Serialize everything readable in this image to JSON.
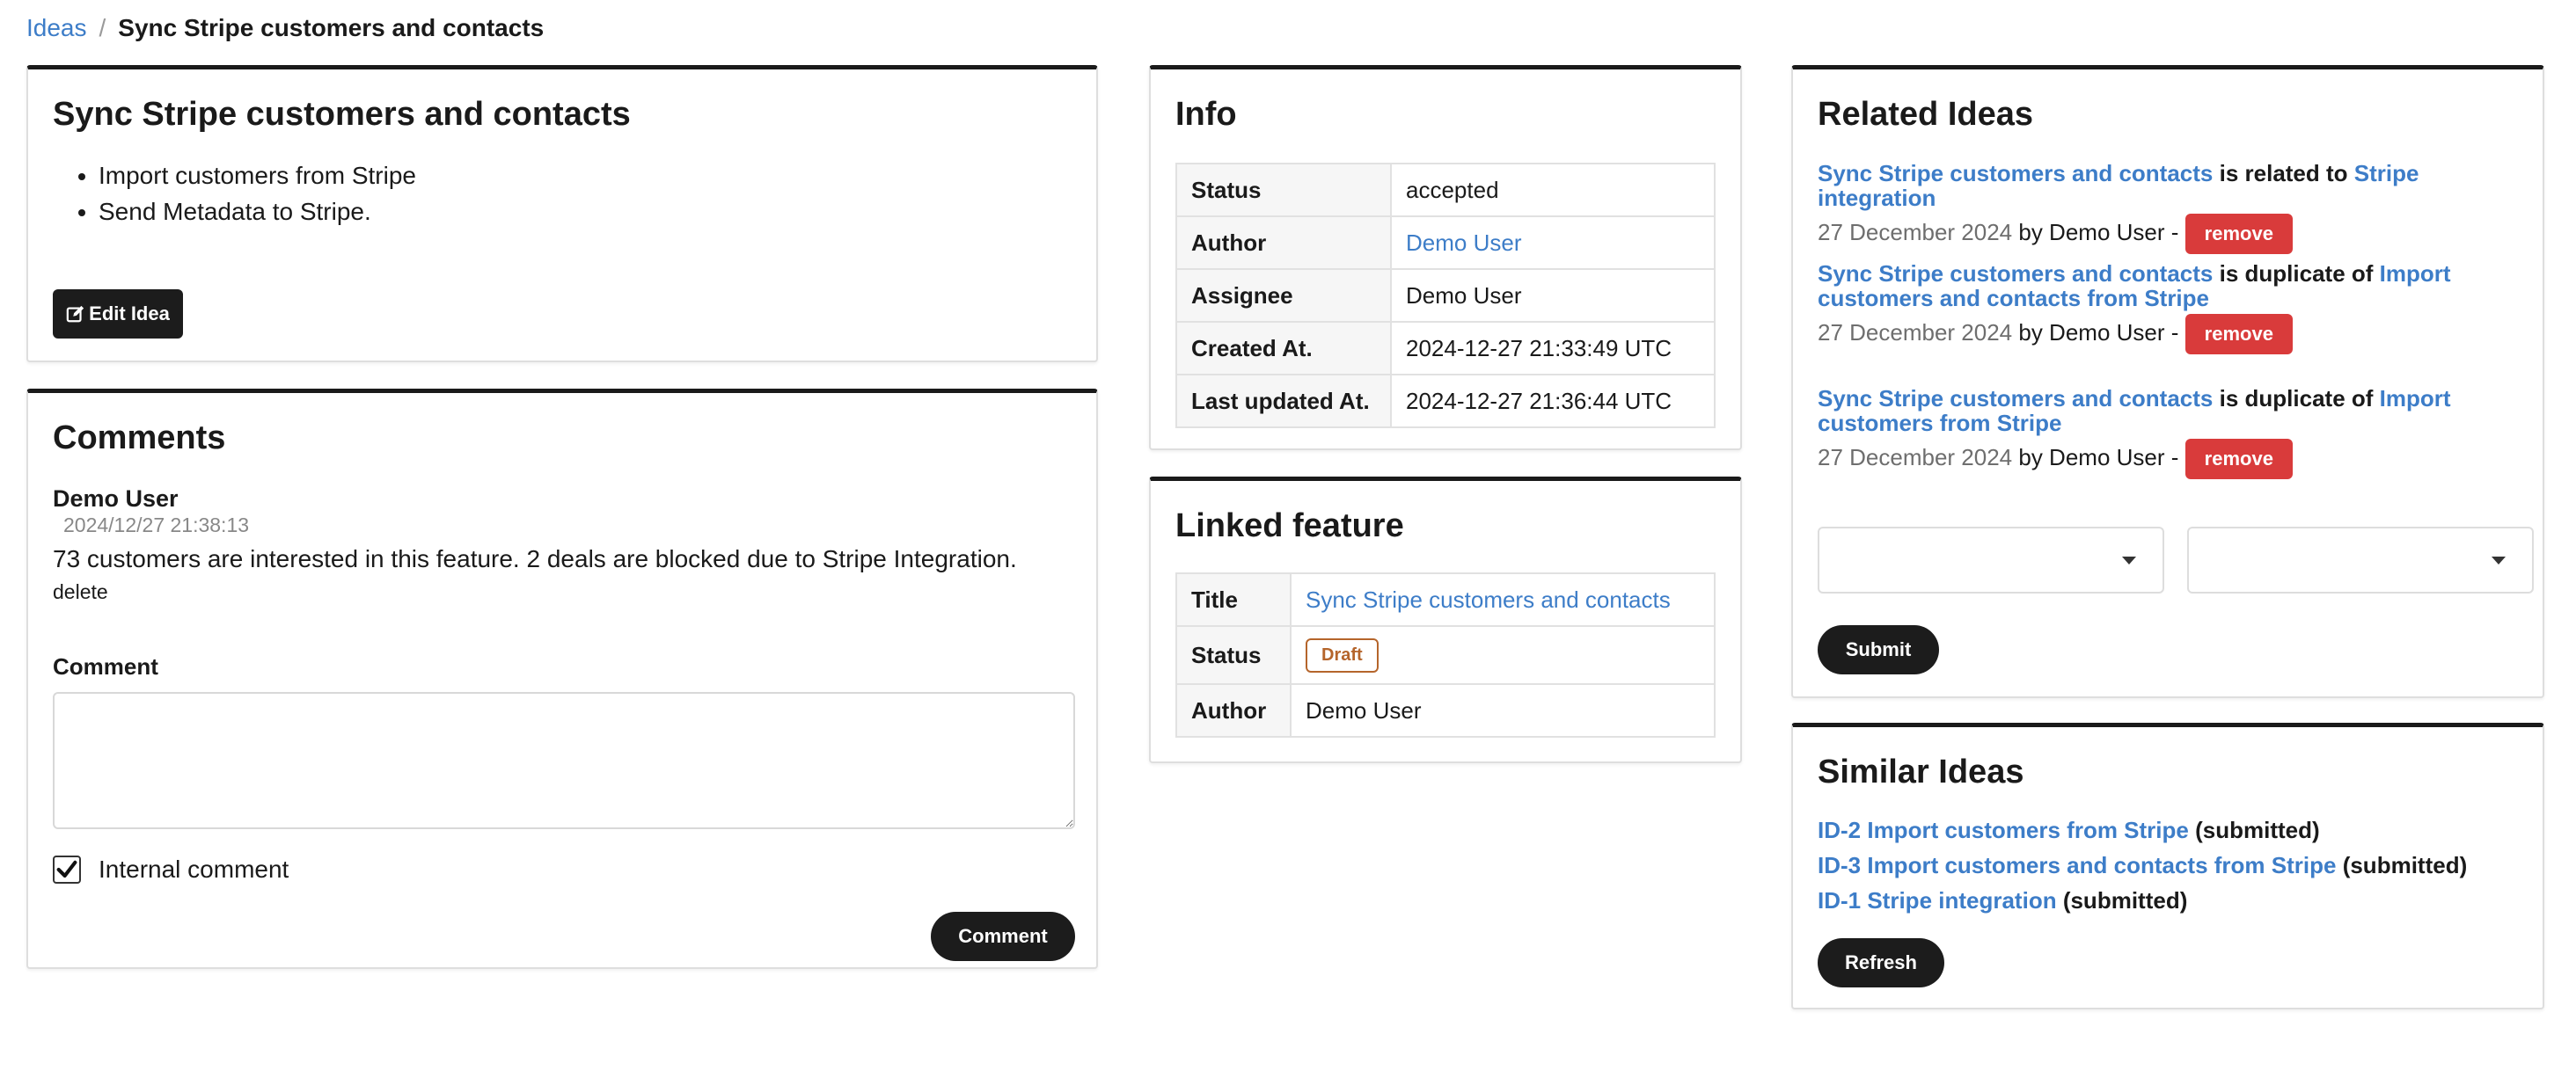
{
  "breadcrumb": {
    "root": "Ideas",
    "separator": "/",
    "current": "Sync Stripe customers and contacts"
  },
  "idea": {
    "title": "Sync Stripe customers and contacts",
    "bullets": [
      "Import customers from Stripe",
      "Send Metadata to Stripe."
    ],
    "edit_label": "Edit Idea"
  },
  "comments": {
    "title": "Comments",
    "items": [
      {
        "author": "Demo User",
        "timestamp": "2024/12/27 21:38:13",
        "text": "73 customers are interested in this feature. 2 deals are blocked due to Stripe Integration.",
        "delete_label": "delete"
      }
    ],
    "form_label": "Comment",
    "textarea_value": "",
    "internal_label": "Internal comment",
    "internal_checked": true,
    "submit_label": "Comment"
  },
  "info": {
    "title": "Info",
    "rows": [
      {
        "key": "Status",
        "value": "accepted"
      },
      {
        "key": "Author",
        "value": "Demo User"
      },
      {
        "key": "Assignee",
        "value": "Demo User"
      },
      {
        "key": "Created At.",
        "value": "2024-12-27 21:33:49 UTC"
      },
      {
        "key": "Last updated At.",
        "value": "2024-12-27 21:36:44 UTC"
      }
    ]
  },
  "linked_feature": {
    "title": "Linked feature",
    "rows": [
      {
        "key": "Title",
        "value": "Sync Stripe customers and contacts"
      },
      {
        "key": "Status",
        "value": "Draft"
      },
      {
        "key": "Author",
        "value": "Demo User"
      }
    ]
  },
  "related": {
    "title": "Related Ideas",
    "items": [
      {
        "source": "Sync Stripe customers and contacts",
        "relation": "is related to",
        "target": "Stripe integration",
        "date": "27 December 2024",
        "by": "by Demo User -",
        "remove_label": "remove"
      },
      {
        "source": "Sync Stripe customers and contacts",
        "relation": "is duplicate of",
        "target": "Import customers and contacts from Stripe",
        "date": "27 December 2024",
        "by": "by Demo User -",
        "remove_label": "remove"
      },
      {
        "source": "Sync Stripe customers and contacts",
        "relation": "is duplicate of",
        "target": "Import customers from Stripe",
        "date": "27 December 2024",
        "by": "by Demo User -",
        "remove_label": "remove"
      }
    ],
    "select_1_value": "",
    "select_2_value": "",
    "submit_label": "Submit"
  },
  "similar": {
    "title": "Similar Ideas",
    "items": [
      {
        "link": "ID-2 Import customers from Stripe",
        "status": "(submitted)"
      },
      {
        "link": "ID-3 Import customers and contacts from Stripe",
        "status": "(submitted)"
      },
      {
        "link": "ID-1 Stripe integration",
        "status": "(submitted)"
      }
    ],
    "refresh_label": "Refresh"
  },
  "colors": {
    "link": "#3d7dc8",
    "danger": "#d93b3b",
    "dark": "#1c1c1c",
    "draft": "#b5652b"
  },
  "icons": {
    "edit": "edit-icon",
    "checkbox": "checkmark-icon",
    "dropdown": "caret-down-icon"
  }
}
